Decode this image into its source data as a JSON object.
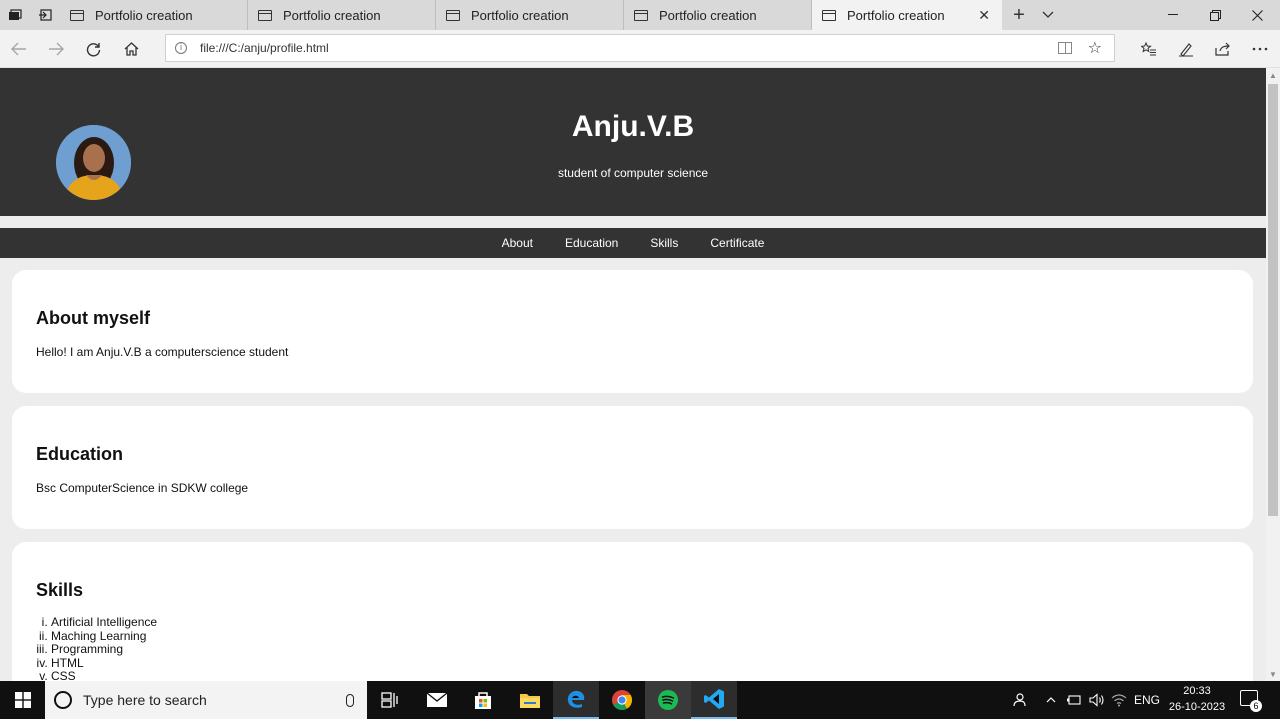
{
  "browser": {
    "tabs": [
      {
        "title": "Portfolio creation"
      },
      {
        "title": "Portfolio creation"
      },
      {
        "title": "Portfolio creation"
      },
      {
        "title": "Portfolio creation"
      },
      {
        "title": "Portfolio creation"
      }
    ],
    "active_tab": 4,
    "address": "file:///C:/anju/profile.html"
  },
  "page": {
    "header": {
      "name": "Anju.V.B",
      "subtitle": "student of computer science"
    },
    "nav": [
      "About",
      "Education",
      "Skills",
      "Certificate"
    ],
    "about": {
      "heading": "About myself",
      "text": "Hello! I am Anju.V.B a computerscience student"
    },
    "education": {
      "heading": "Education",
      "text": "Bsc ComputerScience in SDKW college"
    },
    "skills": {
      "heading": "Skills",
      "items": [
        "Artificial Intelligence",
        "Maching Learning",
        "Programming",
        "HTML",
        "CSS"
      ]
    }
  },
  "taskbar": {
    "search_placeholder": "Type here to search",
    "language": "ENG",
    "time": "20:33",
    "date": "26-10-2023",
    "notification_count": "6"
  },
  "colors": {
    "header_bg": "#333333",
    "page_bg": "#ededed",
    "card_bg": "#ffffff",
    "taskbar_bg": "#101010"
  }
}
